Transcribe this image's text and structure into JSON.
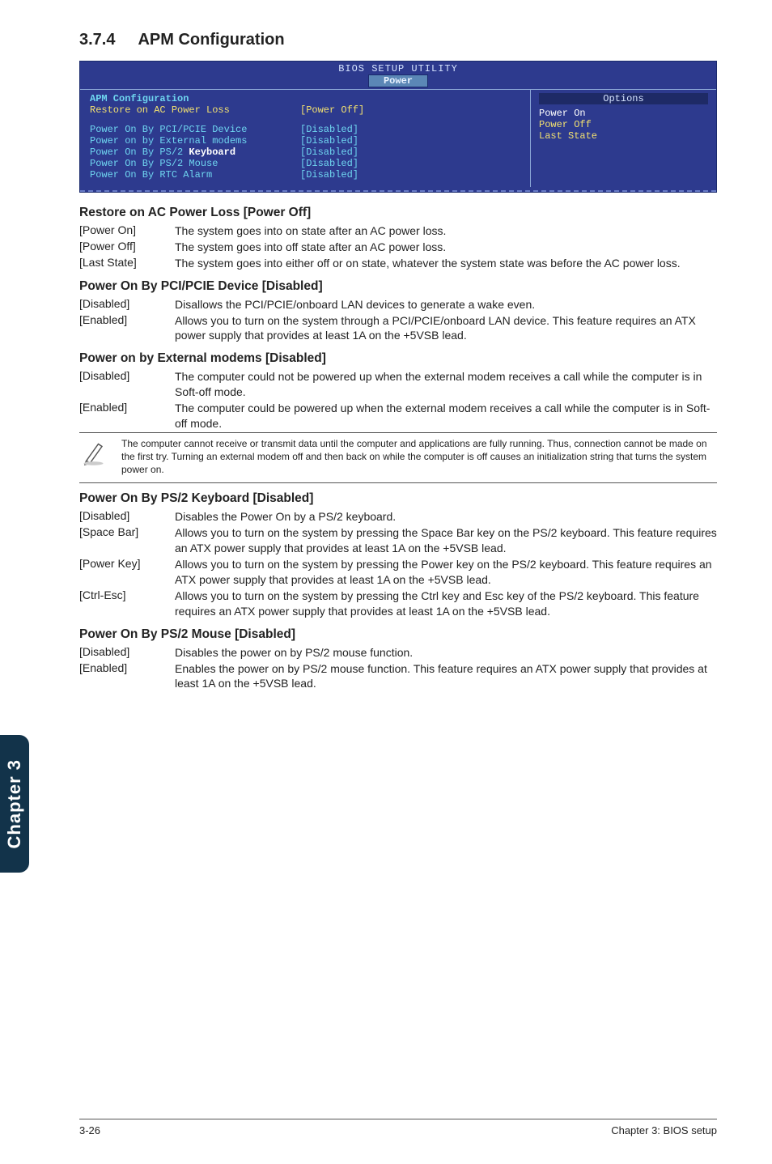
{
  "section": {
    "num": "3.7.4",
    "title": "APM Configuration"
  },
  "bios": {
    "topbar": "BIOS SETUP UTILITY",
    "tab": "Power",
    "left": {
      "title": "APM Configuration",
      "restore_lbl": "Restore on AC Power Loss",
      "restore_val": "[Power Off]",
      "rows": [
        {
          "lbl": "Power On By PCI/PCIE Device",
          "val": "[Disabled]"
        },
        {
          "lbl": "Power on by External modems",
          "val": "[Disabled]",
          "kb": ""
        },
        {
          "lbl": "Power On By PS/2 ",
          "kb": "Keyboard",
          "val": "[Disabled]"
        },
        {
          "lbl": "Power On By PS/2 Mouse",
          "val": "[Disabled]"
        },
        {
          "lbl": "Power On By RTC Alarm",
          "val": "[Disabled]"
        }
      ]
    },
    "right": {
      "options": "Options",
      "items": [
        "Power On",
        "Power Off",
        "Last State"
      ]
    }
  },
  "groups": [
    {
      "title": "Restore on AC Power Loss [Power Off]",
      "rows": [
        {
          "term": "[Power On]",
          "def": "The system goes into on state after an AC power loss."
        },
        {
          "term": "[Power Off]",
          "def": "The system goes into off state after an AC power loss."
        },
        {
          "term": "[Last State]",
          "def": "The system goes into either off or on state, whatever the system state was before the AC power loss."
        }
      ]
    },
    {
      "title": "Power On By PCI/PCIE Device [Disabled]",
      "rows": [
        {
          "term": "[Disabled]",
          "def": "Disallows the PCI/PCIE/onboard LAN devices to generate a wake even."
        },
        {
          "term": "[Enabled]",
          "def": "Allows you to turn on the system through a PCI/PCIE/onboard LAN device. This feature requires an ATX power supply that provides at least 1A on the +5VSB lead."
        }
      ]
    },
    {
      "title": "Power on by External modems [Disabled]",
      "rows": [
        {
          "term": "[Disabled]",
          "def": "The computer could not be powered up when the external modem receives a call while the computer is in Soft-off mode."
        },
        {
          "term": "[Enabled]",
          "def": "The computer could be powered up when the external modem receives a call while the computer is in Soft-off mode."
        }
      ]
    }
  ],
  "note": "The computer cannot receive or transmit data until the computer and applications are fully running. Thus, connection cannot be made on the first try. Turning an external modem off and then back on while the computer is off causes an initialization string that turns the system power on.",
  "groups2": [
    {
      "title": "Power On By PS/2 Keyboard [Disabled]",
      "rows": [
        {
          "term": "[Disabled]",
          "def": "Disables the Power On by a PS/2 keyboard."
        },
        {
          "term": "[Space Bar]",
          "def": "Allows you to turn on the system by pressing the Space Bar key on the PS/2 keyboard. This feature requires an ATX power supply that provides at least 1A on the +5VSB lead."
        },
        {
          "term": "[Power Key]",
          "def": "Allows you to turn on the system by pressing the Power key on the PS/2 keyboard. This feature requires an ATX power supply that provides at least 1A on the +5VSB lead."
        },
        {
          "term": "[Ctrl-Esc]",
          "def": "Allows you to turn on the system by pressing the Ctrl key and Esc key of the PS/2 keyboard. This feature requires an ATX power supply that provides at least 1A on the +5VSB lead."
        }
      ]
    },
    {
      "title": "Power On By PS/2 Mouse [Disabled]",
      "rows": [
        {
          "term": "[Disabled]",
          "def": "Disables the power on by PS/2 mouse function."
        },
        {
          "term": "[Enabled]",
          "def": "Enables the power on by PS/2 mouse function. This feature requires an ATX power supply that provides at least 1A on the +5VSB lead."
        }
      ]
    }
  ],
  "sidetab": "Chapter 3",
  "footer": {
    "left": "3-26",
    "right": "Chapter 3: BIOS setup"
  }
}
